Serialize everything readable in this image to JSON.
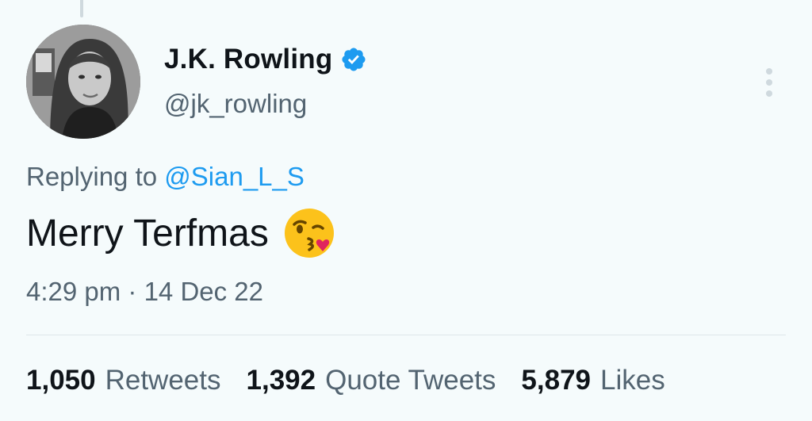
{
  "tweet": {
    "author": {
      "display_name": "J.K. Rowling",
      "handle": "@jk_rowling",
      "verified": true,
      "avatar_icon": "avatar-portrait"
    },
    "reply": {
      "prefix": "Replying to",
      "mention": "@Sian_L_S"
    },
    "text": "Merry Terfmas",
    "emoji_icon": "face-blowing-kiss-emoji",
    "timestamp": "4:29 pm · 14 Dec 22",
    "stats": [
      {
        "count": "1,050",
        "label": "Retweets"
      },
      {
        "count": "1,392",
        "label": "Quote Tweets"
      },
      {
        "count": "5,879",
        "label": "Likes"
      }
    ]
  },
  "colors": {
    "background": "#f5fbfc",
    "primary_text": "#0f1419",
    "secondary_text": "#536471",
    "accent": "#1d9bf0"
  }
}
